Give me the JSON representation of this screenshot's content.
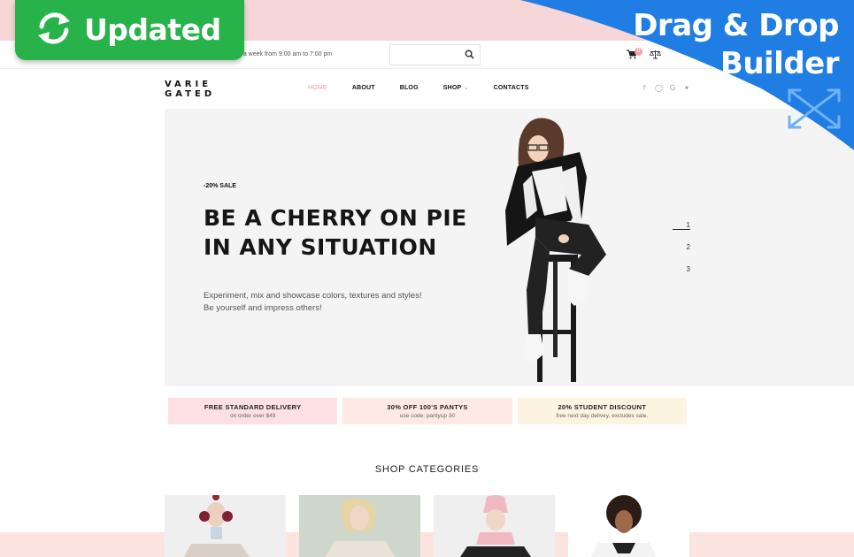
{
  "badge": {
    "updated_label": "Updated"
  },
  "corner_banner": {
    "line1": "Drag & Drop",
    "line2": "Builder"
  },
  "topbar": {
    "info_text": "ays a week from 9:00 am to 7:00 pm",
    "search": {
      "value": "",
      "placeholder": ""
    },
    "cart_count": "0"
  },
  "header": {
    "logo_line1": "VARIE",
    "logo_line2": "GATED",
    "nav": [
      {
        "label": "HOME",
        "active": true
      },
      {
        "label": "ABOUT"
      },
      {
        "label": "BLOG"
      },
      {
        "label": "SHOP",
        "has_dropdown": true
      },
      {
        "label": "CONTACTS"
      }
    ],
    "social_icons": [
      "facebook-icon",
      "instagram-icon",
      "google-icon",
      "twitter-icon"
    ]
  },
  "hero": {
    "sale_label": "-20% SALE",
    "title_line1": "BE A CHERRY ON PIE",
    "title_line2": "IN ANY SITUATION",
    "desc_line1": "Experiment, mix and showcase colors, textures and styles!",
    "desc_line2": "Be yourself and impress others!",
    "slides": [
      "1",
      "2",
      "3"
    ],
    "active_slide": 1
  },
  "promos": [
    {
      "title": "FREE STANDARD DELIVERY",
      "sub": "on order over $49",
      "color": "#fde0e3"
    },
    {
      "title": "30% OFF 100'S PANTYS",
      "sub": "use code: pantyup 30",
      "color": "#fde9e4"
    },
    {
      "title": "20% STUDENT DISCOUNT",
      "sub": "free next day delivey, excludes sale.",
      "color": "#fdf3e1"
    }
  ],
  "categories": {
    "title": "SHOP CATEGORIES"
  },
  "colors": {
    "accent_pink": "#f09da3",
    "top_band": "#f7d6d8",
    "updated_green": "#27b24a",
    "corner_blue": "#1f7de3"
  }
}
